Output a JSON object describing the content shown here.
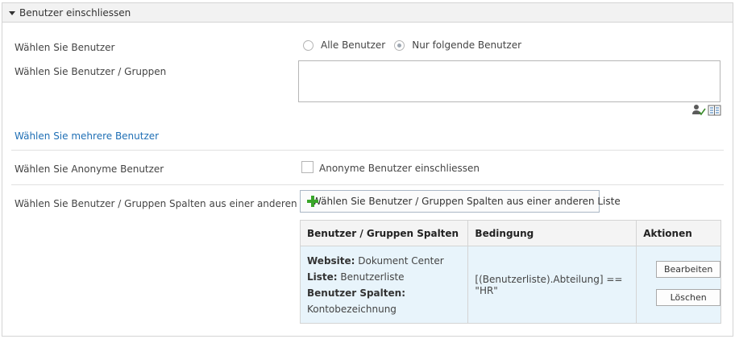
{
  "panel": {
    "title": "Benutzer einschliessen"
  },
  "select_users": {
    "label": "Wählen Sie Benutzer",
    "options": [
      "Alle Benutzer",
      "Nur folgende Benutzer"
    ],
    "selected": "Nur folgende Benutzer"
  },
  "users_groups": {
    "label": "Wählen Sie Benutzer / Gruppen",
    "value": ""
  },
  "multi_link": "Wählen Sie mehrere Benutzer",
  "anonymous": {
    "label": "Wählen Sie Anonyme Benutzer",
    "checkbox_label": "Anonyme Benutzer einschliessen",
    "checked": false
  },
  "columns_from_list": {
    "label": "Wählen Sie Benutzer / Gruppen Spalten aus einer anderen Liste",
    "button_label": "Wählen Sie Benutzer / Gruppen Spalten aus einer anderen Liste"
  },
  "table": {
    "headers": [
      "Benutzer / Gruppen Spalten",
      "Bedingung",
      "Aktionen"
    ],
    "rows": [
      {
        "website_label": "Website:",
        "website_value": "Dokument Center",
        "list_label": "Liste:",
        "list_value": "Benutzerliste",
        "columns_label": "Benutzer Spalten:",
        "columns_value": "Kontobezeichnung",
        "condition": "[(Benutzerliste).Abteilung] == \"HR\"",
        "edit_label": "Bearbeiten",
        "delete_label": "Löschen"
      }
    ]
  },
  "icons": {
    "people_picker": "check-names-icon",
    "address_book": "browse-directory-icon"
  },
  "colors": {
    "link": "#1f6fb5",
    "row_highlight": "#e8f4fb",
    "add_icon": "#3aa62a"
  }
}
